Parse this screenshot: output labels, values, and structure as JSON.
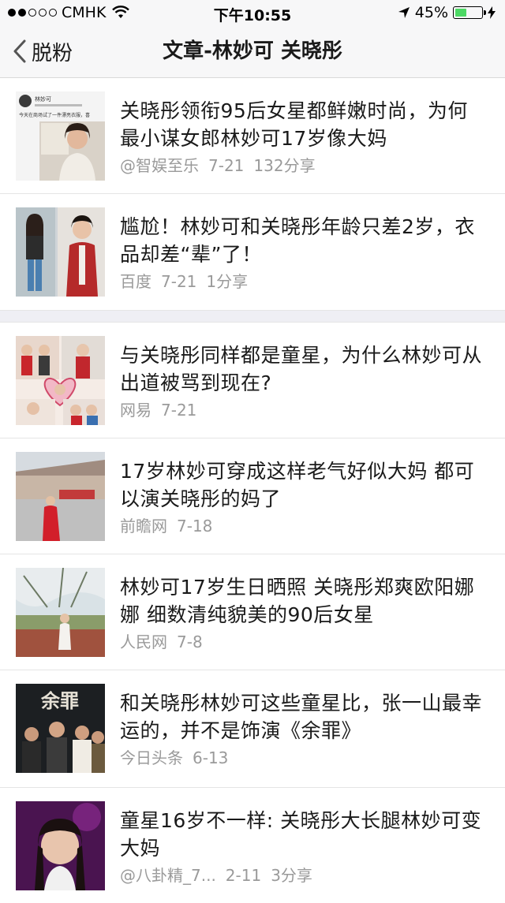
{
  "status_bar": {
    "carrier": "CMHK",
    "time": "下午10:55",
    "battery": "45%",
    "battery_level": 0.45
  },
  "nav": {
    "back_label": "脱粉",
    "title": "文章-林妙可 关晓彤"
  },
  "articles": [
    {
      "title": "关晓彤领衔95后女星都鲜嫩时尚，为何最小谋女郎林妙可17岁像大妈",
      "source": "@智娱至乐",
      "date": "7-21",
      "shares": "132分享",
      "thumb_caption_name": "林妙可",
      "thumb_caption_text": "今天在商场试了一件漂亮衣服，喜"
    },
    {
      "title": "尴尬！林妙可和关晓彤年龄只差2岁，衣品却差“辈”了！",
      "source": "百度",
      "date": "7-21",
      "shares": "1分享"
    },
    {
      "title": "与关晓彤同样都是童星，为什么林妙可从出道被骂到现在?",
      "source": "网易",
      "date": "7-21",
      "shares": ""
    },
    {
      "title": "17岁林妙可穿成这样老气好似大妈 都可以演关晓彤的妈了",
      "source": "前瞻网",
      "date": "7-18",
      "shares": ""
    },
    {
      "title": "林妙可17岁生日晒照 关晓彤郑爽欧阳娜娜 细数清纯貌美的90后女星",
      "source": "人民网",
      "date": "7-8",
      "shares": ""
    },
    {
      "title": "和关晓彤林妙可这些童星比，张一山最幸运的，并不是饰演《余罪》",
      "source": "今日头条",
      "date": "6-13",
      "shares": "",
      "thumb_text": "余罪"
    },
    {
      "title": "童星16岁不一样: 关晓彤大长腿林妙可变大妈",
      "source": "@八卦精_7...",
      "date": "2-11",
      "shares": "3分享"
    }
  ]
}
